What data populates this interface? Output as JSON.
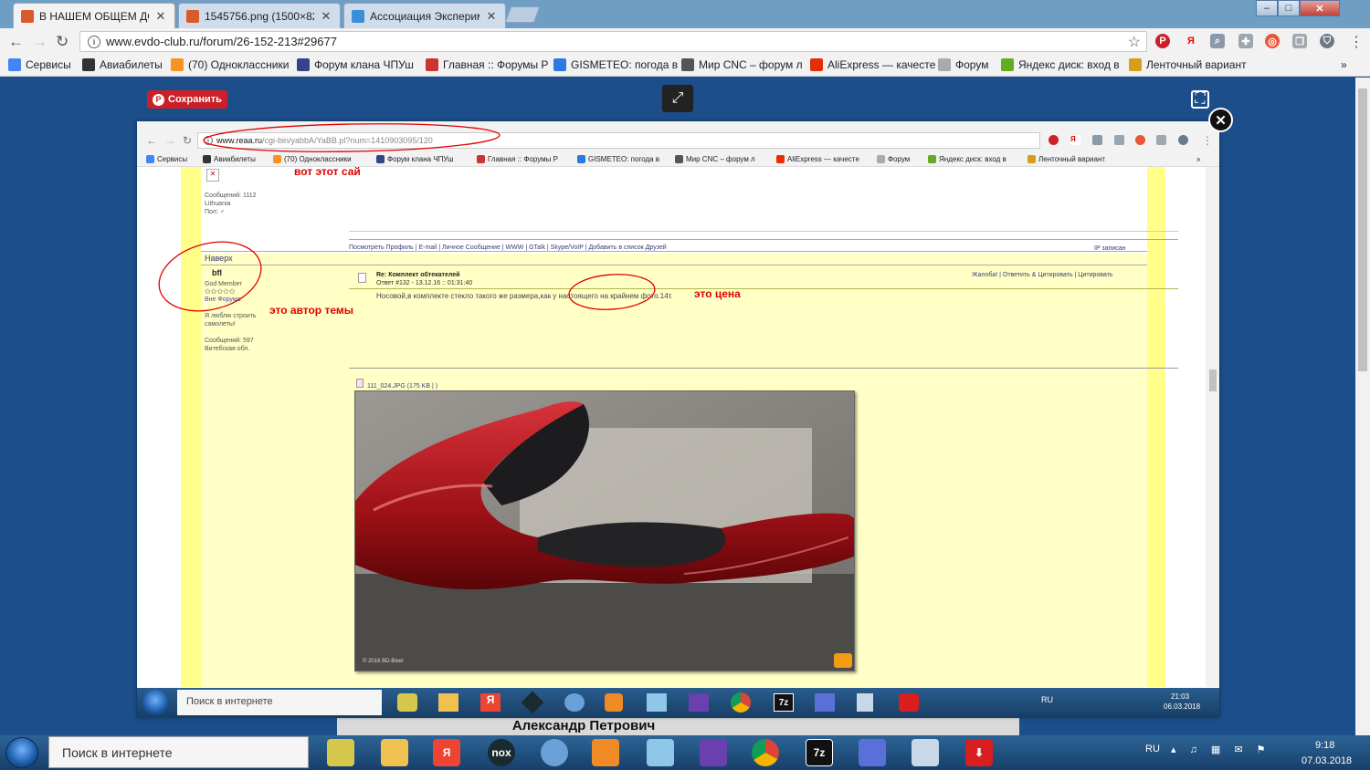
{
  "browser": {
    "tabs": [
      {
        "label": "В НАШЕМ ОБЩЕМ ДОМ",
        "active": true
      },
      {
        "label": "1545756.png (1500×825)",
        "active": false
      },
      {
        "label": "Ассоциация Эксперимe",
        "active": false
      }
    ],
    "url": "www.evdo-club.ru/forum/26-152-213#29677",
    "window_controls": {
      "minimize": "‒",
      "maximize": "□",
      "close": "✕"
    }
  },
  "bookmarks": [
    {
      "label": "Сервисы",
      "icon": "apps-grid-icon",
      "color": "#4285f4"
    },
    {
      "label": "Авиабилеты",
      "icon": "plane-icon",
      "color": "#333333"
    },
    {
      "label": "(70) Одноклассники",
      "icon": "ok-icon",
      "color": "#f7931e"
    },
    {
      "label": "Форум клана ЧПУш",
      "icon": "forum-icon",
      "color": "#334488"
    },
    {
      "label": "Главная :: Форумы Р",
      "icon": "forum2-icon",
      "color": "#cc3333"
    },
    {
      "label": "GISMETEO: погода в",
      "icon": "gismeteo-icon",
      "color": "#2a7ae2"
    },
    {
      "label": "Мир CNC – форум л",
      "icon": "cnc-icon",
      "color": "#555555"
    },
    {
      "label": "AliExpress — качестe",
      "icon": "aliexpress-icon",
      "color": "#e62e04"
    },
    {
      "label": "Форум",
      "icon": "forum3-icon",
      "color": "#888888"
    },
    {
      "label": "Яндекс диск: вход в",
      "icon": "yandex-disk-icon",
      "color": "#66aa22"
    },
    {
      "label": "Ленточный вариант",
      "icon": "tape-icon",
      "color": "#d4a017"
    }
  ],
  "lightbox": {
    "save_label": "Сохранить",
    "caption": "Александр Петрович"
  },
  "inner": {
    "url_host": "www.reaa.ru",
    "url_path": "/cgi-bin/yabbA/YaBB.pl?num=1410903095/120",
    "bookmarks": [
      "Сервисы",
      "Авиабилеты",
      "(70) Одноклассники",
      "Форум клана ЧПУш",
      "Главная :: Форумы Р",
      "GISMETEO: погода в",
      "Мир CNC – форум л",
      "AliExpress — качестe",
      "Форум",
      "Яндекс диск: вход в",
      "Ленточный вариант"
    ],
    "prev_post": {
      "messages": "Сообщений: 1112",
      "location": "Lithuania",
      "gender": "Пол: ♂"
    },
    "prev_links": "Посмотреть Профиль | E-mail | Личное Сообщение | WWW | GTalk | Skype/VoIP | Добавить в список Друзей",
    "ip": "IP записан",
    "top_link": "Наверх",
    "author": {
      "name": "bfl",
      "rank": "God Member",
      "stars": "✩✩✩✩✩",
      "status": "Вне Форума",
      "bio": "Я люблю строить самолеты!",
      "messages": "Сообщений: 597",
      "location": "Витебская обл."
    },
    "post": {
      "title": "Re: Комплект обтекателей",
      "meta": "Ответ #132 - 13.12.16 :: 01:31:40",
      "actions": "Жалоба! | Ответить & Цитировать | Цитировать",
      "body": "Носовой,в комплекте стекло такого же размера,как у настоящего на крайнем фото.14т.",
      "attachment": "111_024.JPG (175 KB | )",
      "photo_watermark": "© 2016 BD-Bixer"
    },
    "taskbar": {
      "search": "Поиск в интернете",
      "lang": "RU",
      "time": "21:03",
      "date": "06.03.2018"
    }
  },
  "annotations": {
    "site": "вот этот сай",
    "author": "это автор темы",
    "price": "это цена"
  },
  "taskbar": {
    "search": "Поиск в интернете",
    "lang": "RU",
    "time": "9:18",
    "date": "07.03.2018"
  }
}
